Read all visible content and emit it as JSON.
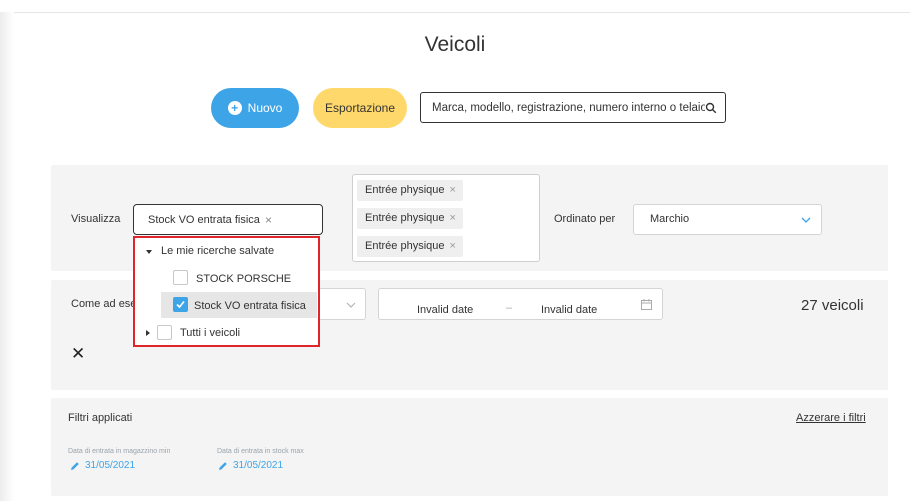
{
  "page": {
    "title": "Veicoli"
  },
  "toolbar": {
    "new_label": "Nuovo",
    "export_label": "Esportazione",
    "search_placeholder": "Marca, modello, registrazione, numero interno o telaio"
  },
  "view_panel": {
    "view_label": "Visualizza",
    "selected_tag": "Stock VO entrata fisica",
    "chips": [
      "Entrée physique",
      "Entrée physique",
      "Entrée physique"
    ],
    "sort_label": "Ordinato per",
    "sort_value": "Marchio"
  },
  "dropdown": {
    "group_saved": "Le mie ricerche salvate",
    "items": [
      {
        "label": "STOCK PORSCHE",
        "checked": false
      },
      {
        "label": "Stock VO entrata fisica",
        "checked": true
      }
    ],
    "group_all": "Tutti i veicoli"
  },
  "filter_panel": {
    "second_label": "Come ad ese",
    "date_from": "Invalid date",
    "date_sep": "–",
    "date_to": "Invalid date",
    "count": "27 veicoli"
  },
  "applied": {
    "title": "Filtri applicati",
    "reset": "Azzerare i filtri",
    "entries": [
      {
        "label": "Data di entrata in magazzino min",
        "value": "31/05/2021"
      },
      {
        "label": "Data di entrata in stock max",
        "value": "31/05/2021"
      }
    ]
  },
  "colors": {
    "accent_blue": "#3ea4e8",
    "accent_yellow": "#fed86a",
    "highlight_red": "#e0242b"
  }
}
